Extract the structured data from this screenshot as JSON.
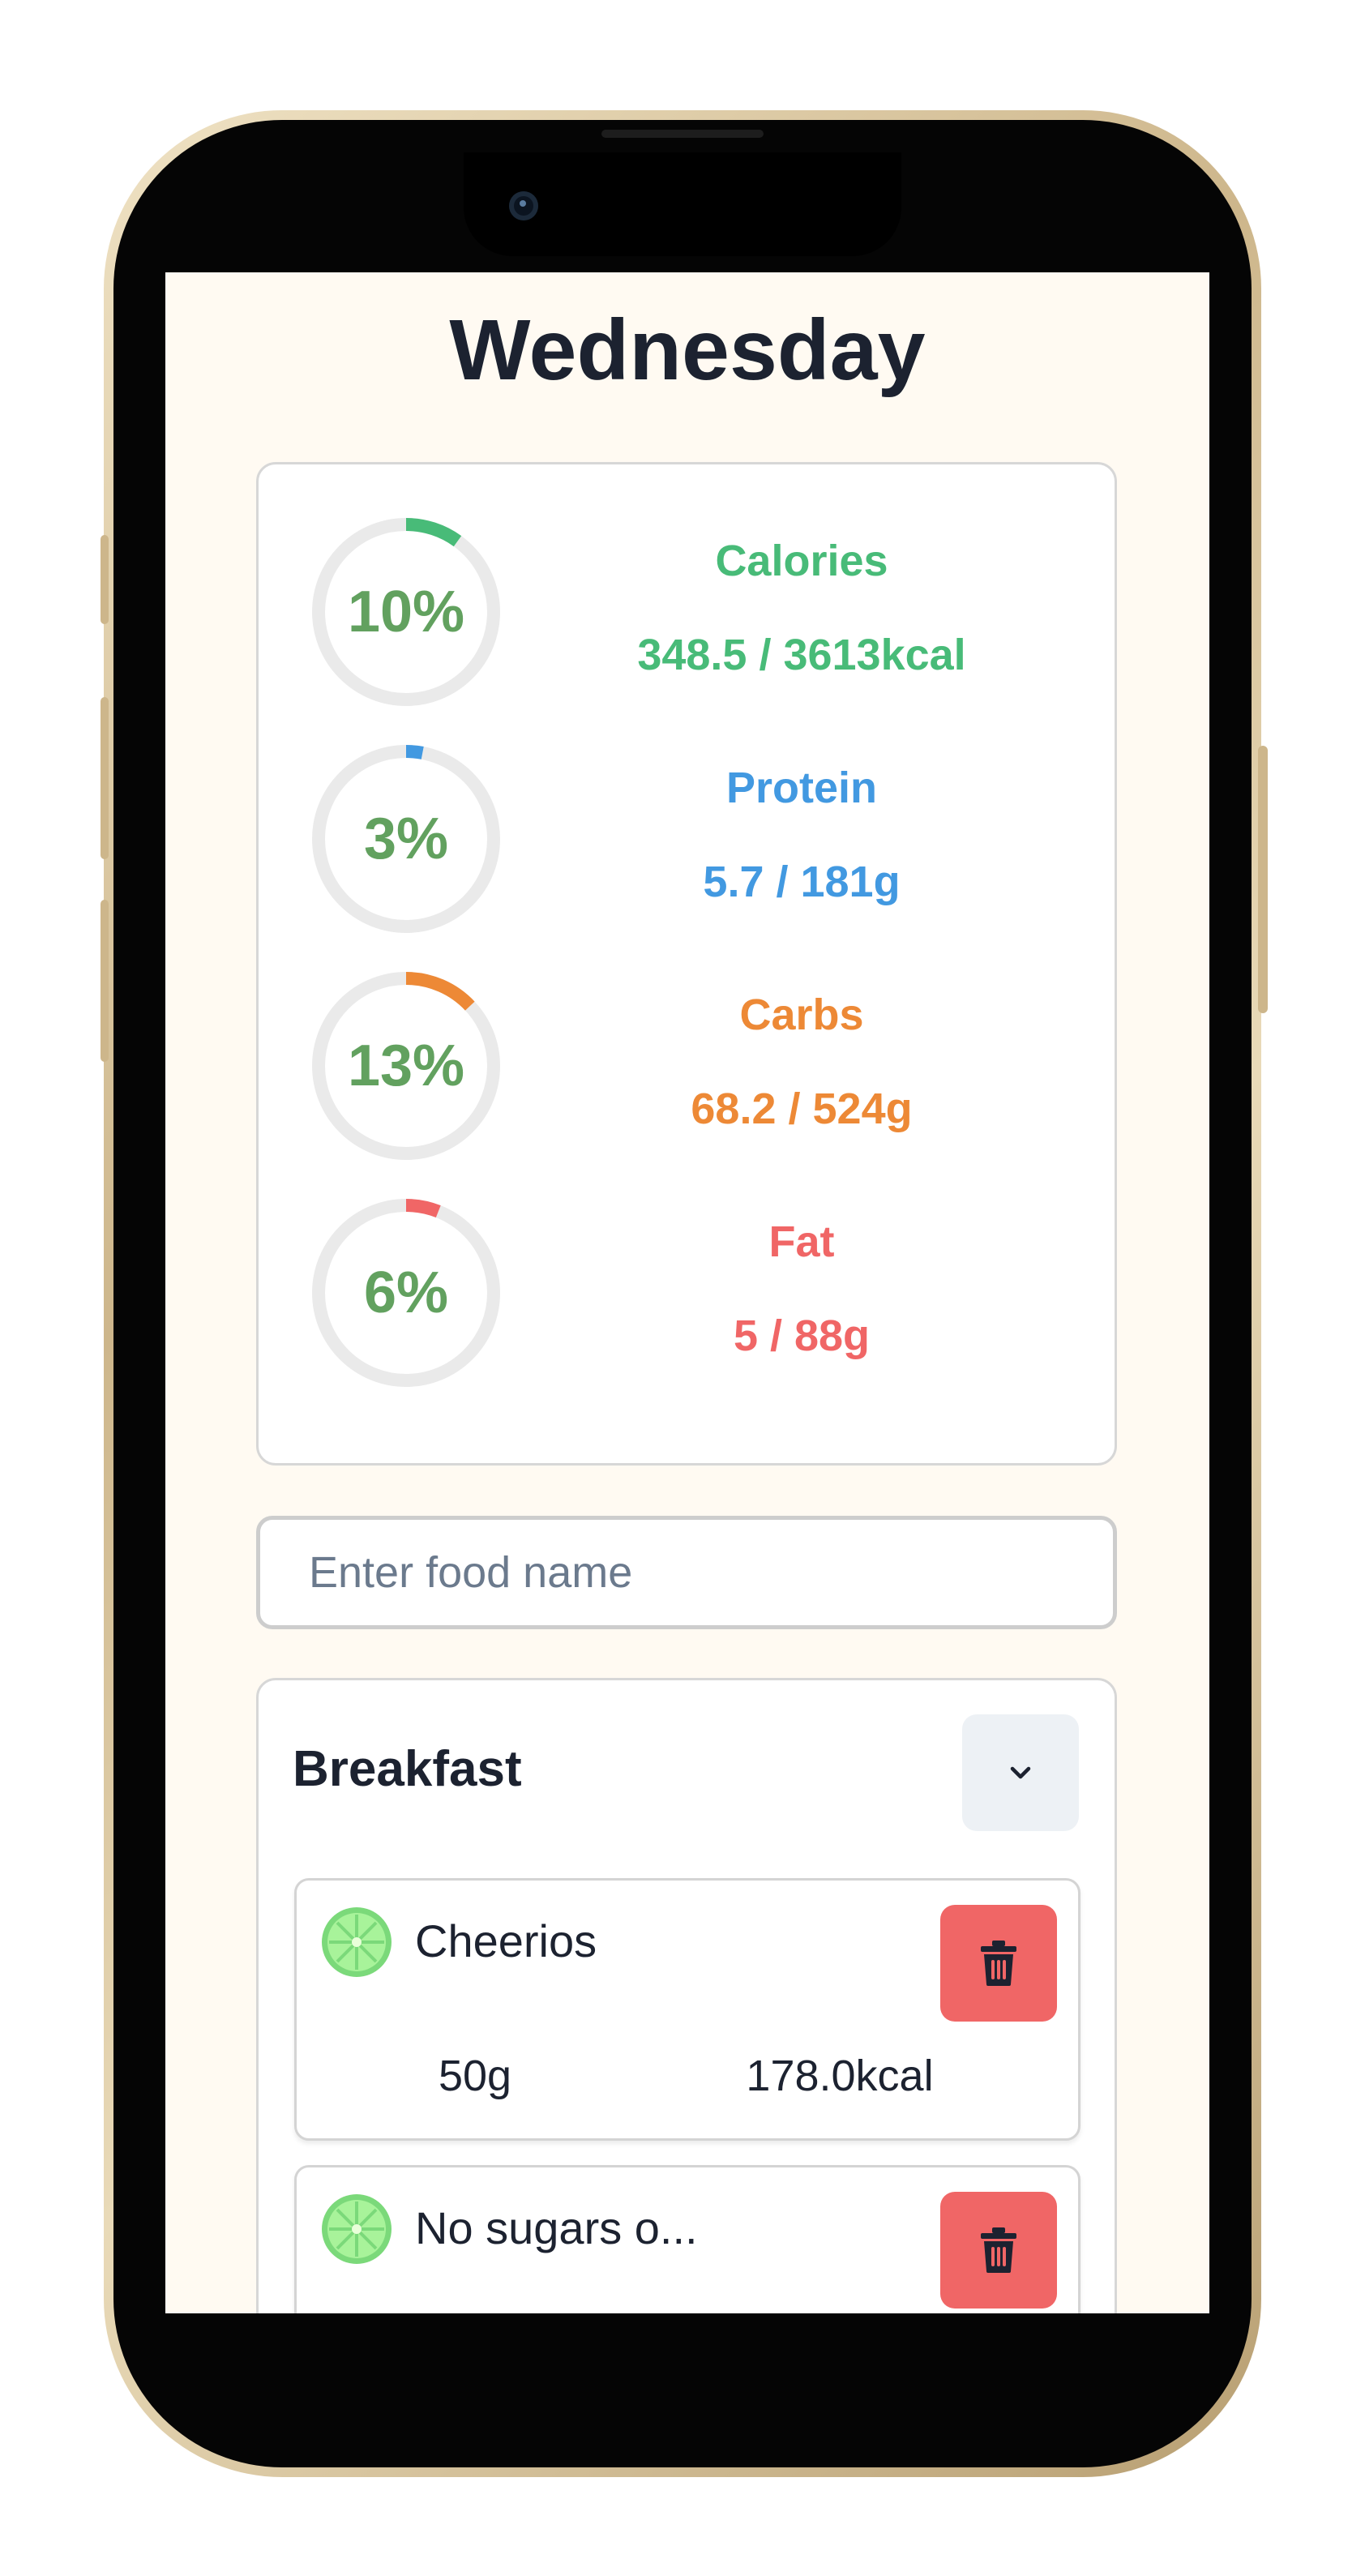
{
  "header": {
    "title": "Wednesday"
  },
  "stats": [
    {
      "key": "calories",
      "percent": 10,
      "percent_label": "10%",
      "label": "Calories",
      "value": "348.5 / 3613kcal",
      "color": "#48bb78"
    },
    {
      "key": "protein",
      "percent": 3,
      "percent_label": "3%",
      "label": "Protein",
      "value": "5.7 / 181g",
      "color": "#4299e1"
    },
    {
      "key": "carbs",
      "percent": 13,
      "percent_label": "13%",
      "label": "Carbs",
      "value": "68.2 / 524g",
      "color": "#ed8936"
    },
    {
      "key": "fat",
      "percent": 6,
      "percent_label": "6%",
      "label": "Fat",
      "value": "5 / 88g",
      "color": "#f06666"
    }
  ],
  "ring_track_color": "#eaeaea",
  "percent_text_color": "#62a15f",
  "search": {
    "placeholder": "Enter food name",
    "value": ""
  },
  "meal": {
    "title": "Breakfast",
    "toggle_icon": "chevron-down-icon",
    "items": [
      {
        "name": "Cheerios",
        "quantity": "50g",
        "calories": "178.0kcal",
        "icon": "lime-icon",
        "delete_icon": "trash-icon"
      },
      {
        "name": "No sugars o...",
        "quantity": "",
        "calories": "",
        "icon": "lime-icon",
        "delete_icon": "trash-icon"
      }
    ]
  },
  "colors": {
    "delete": "#f06666",
    "background": "#fffaf2",
    "text": "#1c2230"
  }
}
